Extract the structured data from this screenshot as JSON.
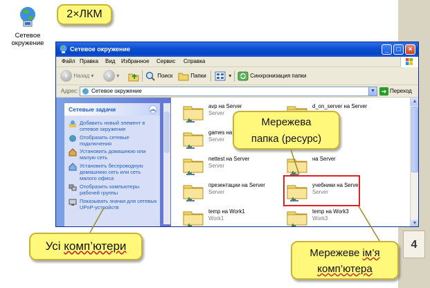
{
  "desktop": {
    "icon_name": "network-places-icon",
    "label_line1": "Сетевое",
    "label_line2": "окружение"
  },
  "callouts": {
    "double_click": "2×ЛКМ",
    "network_folder_line1": "Мережева",
    "network_folder_line2": "папка (ресурс)",
    "all_computers_prefix": "Усі ",
    "all_computers_underlined": "комп’ютери",
    "network_name_prefix": "Мережеве ",
    "network_name_underlined1": "ім’я",
    "network_name_underlined2": "комп’ютера"
  },
  "window": {
    "title": "Сетевое окружение",
    "menu": [
      "Файл",
      "Правка",
      "Вид",
      "Избранное",
      "Сервис",
      "Справка"
    ],
    "toolbar": {
      "back": "Назад",
      "search": "Поиск",
      "folders": "Папки",
      "sync": "Синхронизация папки"
    },
    "address": {
      "label": "Адрес:",
      "value": "Сетевое окружение",
      "go": "Переход"
    },
    "tasks": {
      "header": "Сетевые задачи",
      "items": [
        "Добавить новый элемент в сетевое окружение",
        "Отобразить сетевые подключения",
        "Установить домашнюю или малую сеть",
        "Установить беспроводную домашнюю сеть или сеть малого офиса",
        "Отобразить компьютеры рабочей группы",
        "Показывать значки для сетевых UPnP-устройств"
      ]
    },
    "files": [
      {
        "name": "avp на Server",
        "sub": "Server"
      },
      {
        "name": "d_on_server на Server",
        "sub": "Server"
      },
      {
        "name": "games на Server",
        "sub": "Server"
      },
      {
        "name": "",
        "sub": ""
      },
      {
        "name": "nettest на Server",
        "sub": "Server"
      },
      {
        "name": "на Server",
        "sub": ""
      },
      {
        "name": "презентации на Server",
        "sub": "Server"
      },
      {
        "name": "учебники на Server",
        "sub": "Server"
      },
      {
        "name": "temp на Work1",
        "sub": "Work1"
      },
      {
        "name": "temp на Work3",
        "sub": "Work3"
      }
    ]
  },
  "page_number": "4",
  "colors": {
    "callout_fill": "#fff87a",
    "titlebar": "#0a4fd1",
    "highlight_border": "#e02020"
  }
}
